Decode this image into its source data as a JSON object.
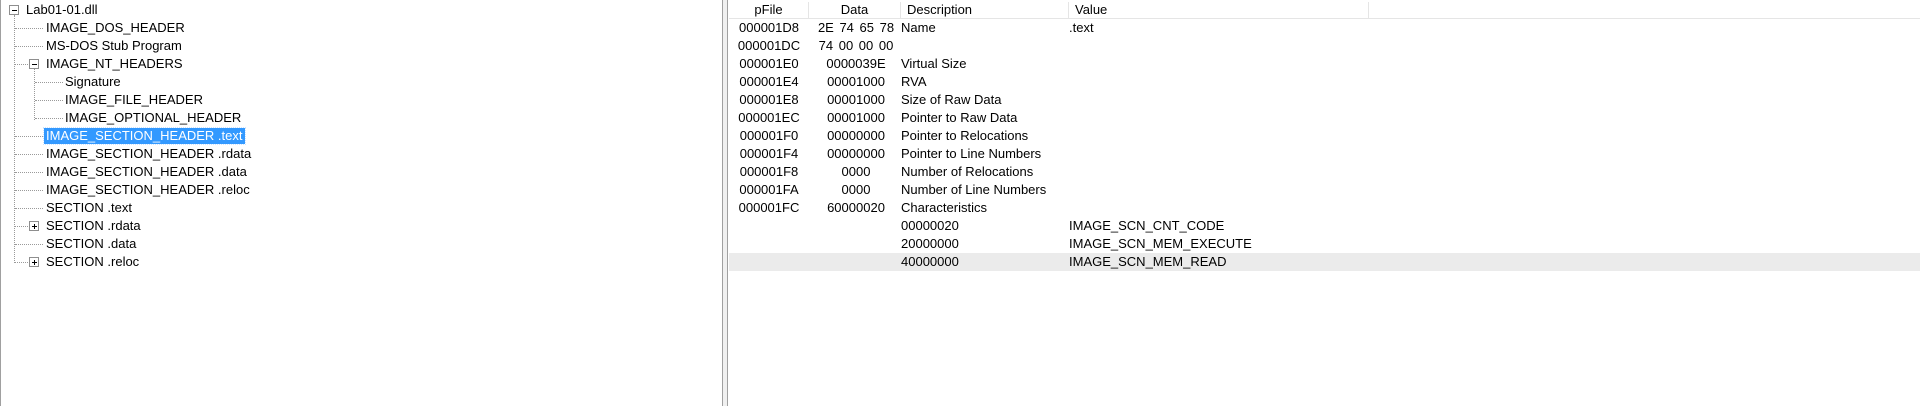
{
  "tree": {
    "root": "Lab01-01.dll",
    "items": [
      "IMAGE_DOS_HEADER",
      "MS-DOS Stub Program",
      "IMAGE_NT_HEADERS",
      "Signature",
      "IMAGE_FILE_HEADER",
      "IMAGE_OPTIONAL_HEADER",
      "IMAGE_SECTION_HEADER .text",
      "IMAGE_SECTION_HEADER .rdata",
      "IMAGE_SECTION_HEADER .data",
      "IMAGE_SECTION_HEADER .reloc",
      "SECTION .text",
      "SECTION .rdata",
      "SECTION .data",
      "SECTION .reloc"
    ],
    "selected": "IMAGE_SECTION_HEADER .text"
  },
  "grid": {
    "columns": [
      "pFile",
      "Data",
      "Description",
      "Value"
    ],
    "rows": [
      {
        "pfile": "000001D8",
        "data": "2E  74  65  78",
        "desc": "Name",
        "value": ".text"
      },
      {
        "pfile": "000001DC",
        "data": "74  00  00  00",
        "desc": "",
        "value": ""
      },
      {
        "pfile": "000001E0",
        "data": "0000039E",
        "desc": "Virtual Size",
        "value": ""
      },
      {
        "pfile": "000001E4",
        "data": "00001000",
        "desc": "RVA",
        "value": ""
      },
      {
        "pfile": "000001E8",
        "data": "00001000",
        "desc": "Size of Raw Data",
        "value": ""
      },
      {
        "pfile": "000001EC",
        "data": "00001000",
        "desc": "Pointer to Raw Data",
        "value": ""
      },
      {
        "pfile": "000001F0",
        "data": "00000000",
        "desc": "Pointer to Relocations",
        "value": ""
      },
      {
        "pfile": "000001F4",
        "data": "00000000",
        "desc": "Pointer to Line Numbers",
        "value": ""
      },
      {
        "pfile": "000001F8",
        "data": "0000",
        "desc": "Number of Relocations",
        "value": ""
      },
      {
        "pfile": "000001FA",
        "data": "0000",
        "desc": "Number of Line Numbers",
        "value": ""
      },
      {
        "pfile": "000001FC",
        "data": "60000020",
        "desc": "Characteristics",
        "value": ""
      },
      {
        "pfile": "",
        "data": "",
        "desc": "00000020",
        "value": "IMAGE_SCN_CNT_CODE"
      },
      {
        "pfile": "",
        "data": "",
        "desc": "20000000",
        "value": "IMAGE_SCN_MEM_EXECUTE"
      },
      {
        "pfile": "",
        "data": "",
        "desc": "40000000",
        "value": "IMAGE_SCN_MEM_READ"
      }
    ]
  }
}
